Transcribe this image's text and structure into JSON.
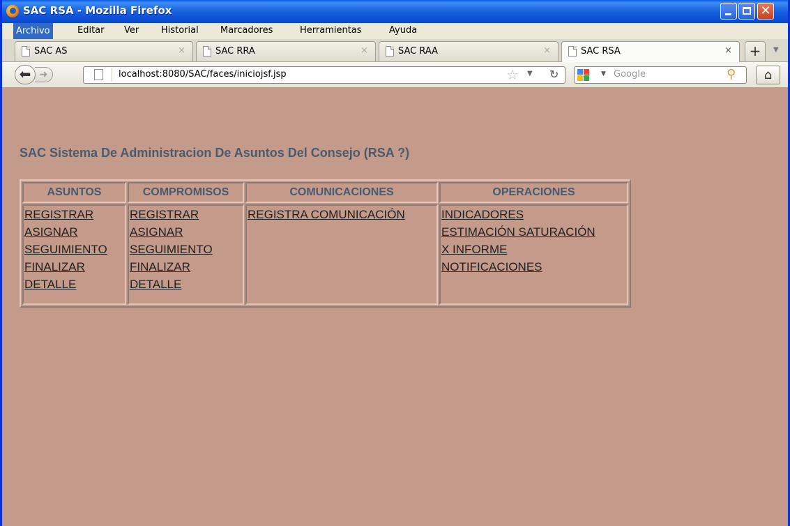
{
  "window": {
    "title": "SAC RSA - Mozilla Firefox",
    "controls": {
      "minimize": "",
      "maximize": "",
      "close": "✕"
    }
  },
  "menubar": [
    {
      "label": "Archivo"
    },
    {
      "label": "Editar"
    },
    {
      "label": "Ver"
    },
    {
      "label": "Historial"
    },
    {
      "label": "Marcadores"
    },
    {
      "label": "Herramientas"
    },
    {
      "label": "Ayuda"
    }
  ],
  "tabs": [
    {
      "label": "SAC AS",
      "close": "×"
    },
    {
      "label": "SAC RRA",
      "close": "×"
    },
    {
      "label": "SAC RAA",
      "close": "×"
    },
    {
      "label": "SAC RSA",
      "close": "×",
      "active": true
    }
  ],
  "newtab_label": "+",
  "address": {
    "url": "localhost:8080/SAC/faces/iniciojsf.jsp"
  },
  "search": {
    "placeholder": "Google"
  },
  "page": {
    "title": "SAC Sistema De Administracion De Asuntos Del Consejo (RSA ?)",
    "table": {
      "headers": [
        "ASUNTOS",
        "COMPROMISOS",
        "COMUNICACIONES",
        "OPERACIONES"
      ],
      "asuntos": [
        "REGISTRAR",
        "ASIGNAR",
        "SEGUIMIENTO",
        "FINALIZAR",
        "DETALLE"
      ],
      "compromisos": [
        "REGISTRAR",
        "ASIGNAR",
        "SEGUIMIENTO",
        "FINALIZAR",
        "DETALLE"
      ],
      "comunicaciones": [
        "REGISTRA COMUNICACIÓN"
      ],
      "operaciones": [
        "INDICADORES",
        "ESTIMACIÓN SATURACIÓN",
        "X INFORME",
        "NOTIFICACIONES"
      ]
    }
  },
  "colors": {
    "page_background": "#c49a8a",
    "title_color": "#4a5b6e"
  }
}
